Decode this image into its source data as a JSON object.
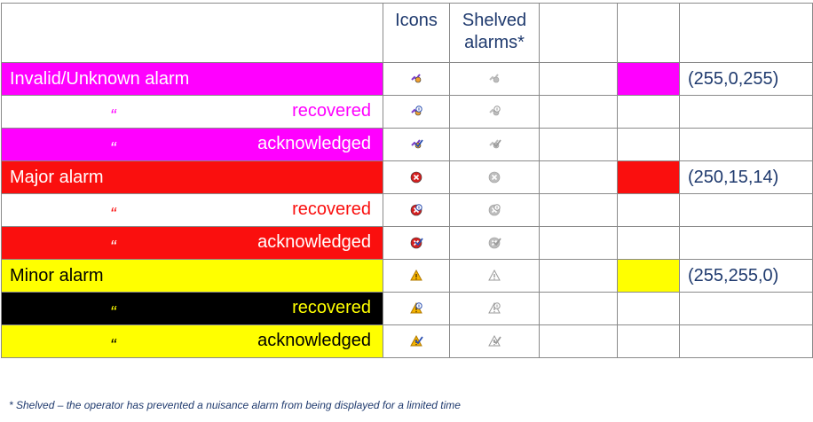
{
  "header": {
    "icons": "Icons",
    "shelved": "Shelved alarms*"
  },
  "rows": [
    {
      "label": "Invalid/Unknown alarm",
      "indent": false,
      "bg": "#ff00ff",
      "fg": "#ffffff",
      "swatch": "#ff00ff",
      "rgb": "(255,0,255)",
      "icon": "invalid"
    },
    {
      "quote": "“",
      "label": "recovered",
      "indent": true,
      "bg": "#ffffff",
      "fg": "#ff00ff",
      "swatch": "",
      "rgb": "",
      "icon": "invalid-recovered"
    },
    {
      "quote": "“",
      "label": "acknowledged",
      "indent": true,
      "bg": "#ff00ff",
      "fg": "#ffffff",
      "swatch": "",
      "rgb": "",
      "icon": "invalid-ack"
    },
    {
      "label": "Major alarm",
      "indent": false,
      "bg": "#fa0f0e",
      "fg": "#ffffff",
      "swatch": "#fa0f0e",
      "rgb": "(250,15,14)",
      "icon": "major"
    },
    {
      "quote": "“",
      "label": "recovered",
      "indent": true,
      "bg": "#ffffff",
      "fg": "#fa0f0e",
      "swatch": "",
      "rgb": "",
      "icon": "major-recovered"
    },
    {
      "quote": "“",
      "label": "acknowledged",
      "indent": true,
      "bg": "#fa0f0e",
      "fg": "#ffffff",
      "swatch": "",
      "rgb": "",
      "icon": "major-ack"
    },
    {
      "label": "Minor alarm",
      "indent": false,
      "bg": "#ffff00",
      "fg": "#000000",
      "swatch": "#ffff00",
      "rgb": "(255,255,0)",
      "icon": "minor"
    },
    {
      "quote": "“",
      "label": "recovered",
      "indent": true,
      "bg": "#000000",
      "fg": "#ffff00",
      "swatch": "",
      "rgb": "",
      "icon": "minor-recovered"
    },
    {
      "quote": "“",
      "label": "acknowledged",
      "indent": true,
      "bg": "#ffff00",
      "fg": "#000000",
      "swatch": "",
      "rgb": "",
      "icon": "minor-ack"
    }
  ],
  "footnote": "* Shelved – the operator has prevented a nuisance alarm from being displayed for a limited time"
}
